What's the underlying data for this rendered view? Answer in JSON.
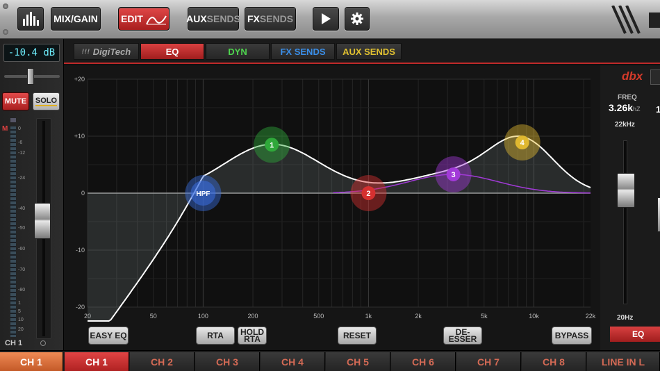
{
  "toolbar": {
    "mix_gain": "MIX/GAIN",
    "edit": "EDIT",
    "aux_sends_a": "AUX",
    "aux_sends_b": "SENDS",
    "fx_sends_a": "FX",
    "fx_sends_b": "SENDS"
  },
  "strip": {
    "gain": "-10.4 dB",
    "mute": "MUTE",
    "solo": "SOLO",
    "meter_m": "M",
    "meter_scale": [
      "0",
      "-6",
      "-12",
      "-24",
      "-40",
      "-50",
      "-60",
      "-70",
      "-80",
      "1",
      "5",
      "10",
      "20"
    ],
    "channel_label": "CH 1"
  },
  "tabs": {
    "brand": "DigiTech",
    "eq": "EQ",
    "dyn": "DYN",
    "fx_sends": "FX SENDS",
    "aux_sends": "AUX SENDS"
  },
  "eq": {
    "y_ticks": [
      {
        "label": "+20",
        "db": 20
      },
      {
        "label": "+10",
        "db": 10
      },
      {
        "label": "0",
        "db": 0
      },
      {
        "label": "-10",
        "db": -10
      },
      {
        "label": "-20",
        "db": -20
      }
    ],
    "x_ticks": [
      {
        "label": "20",
        "hz": 20
      },
      {
        "label": "50",
        "hz": 50
      },
      {
        "label": "100",
        "hz": 100
      },
      {
        "label": "200",
        "hz": 200
      },
      {
        "label": "500",
        "hz": 500
      },
      {
        "label": "1k",
        "hz": 1000
      },
      {
        "label": "2k",
        "hz": 2000
      },
      {
        "label": "5k",
        "hz": 5000
      },
      {
        "label": "10k",
        "hz": 10000
      },
      {
        "label": "22k",
        "hz": 22000
      }
    ],
    "bands": [
      {
        "label": "HPF",
        "hz": 100,
        "db": 0,
        "color": "#3a6ee0"
      },
      {
        "label": "1",
        "hz": 260,
        "db": 8.5,
        "color": "#2fa83a"
      },
      {
        "label": "2",
        "hz": 1000,
        "db": 0,
        "color": "#d63030"
      },
      {
        "label": "3",
        "hz": 3260,
        "db": 3.3,
        "color": "#a23ad8"
      },
      {
        "label": "4",
        "hz": 8500,
        "db": 8.9,
        "color": "#e0b830"
      }
    ],
    "buttons": {
      "easy_eq": "EASY EQ",
      "rta": "RTA",
      "hold_rta_a": "HOLD",
      "hold_rta_b": "RTA",
      "reset": "RESET",
      "de_esser": "DE-ESSER",
      "bypass": "BYPASS"
    }
  },
  "right": {
    "brand": "dbx",
    "freq_label": "FREQ",
    "freq_value": "3.26k",
    "freq_unit": "hZ",
    "top_range": "22kHz",
    "bottom_range": "20Hz",
    "eq_button": "EQ",
    "second_fader_partial": "1"
  },
  "channels": {
    "current": "CH 1",
    "items": [
      "CH 1",
      "CH 2",
      "CH 3",
      "CH 4",
      "CH 5",
      "CH 6",
      "CH 7",
      "CH 8",
      "LINE IN L"
    ]
  }
}
